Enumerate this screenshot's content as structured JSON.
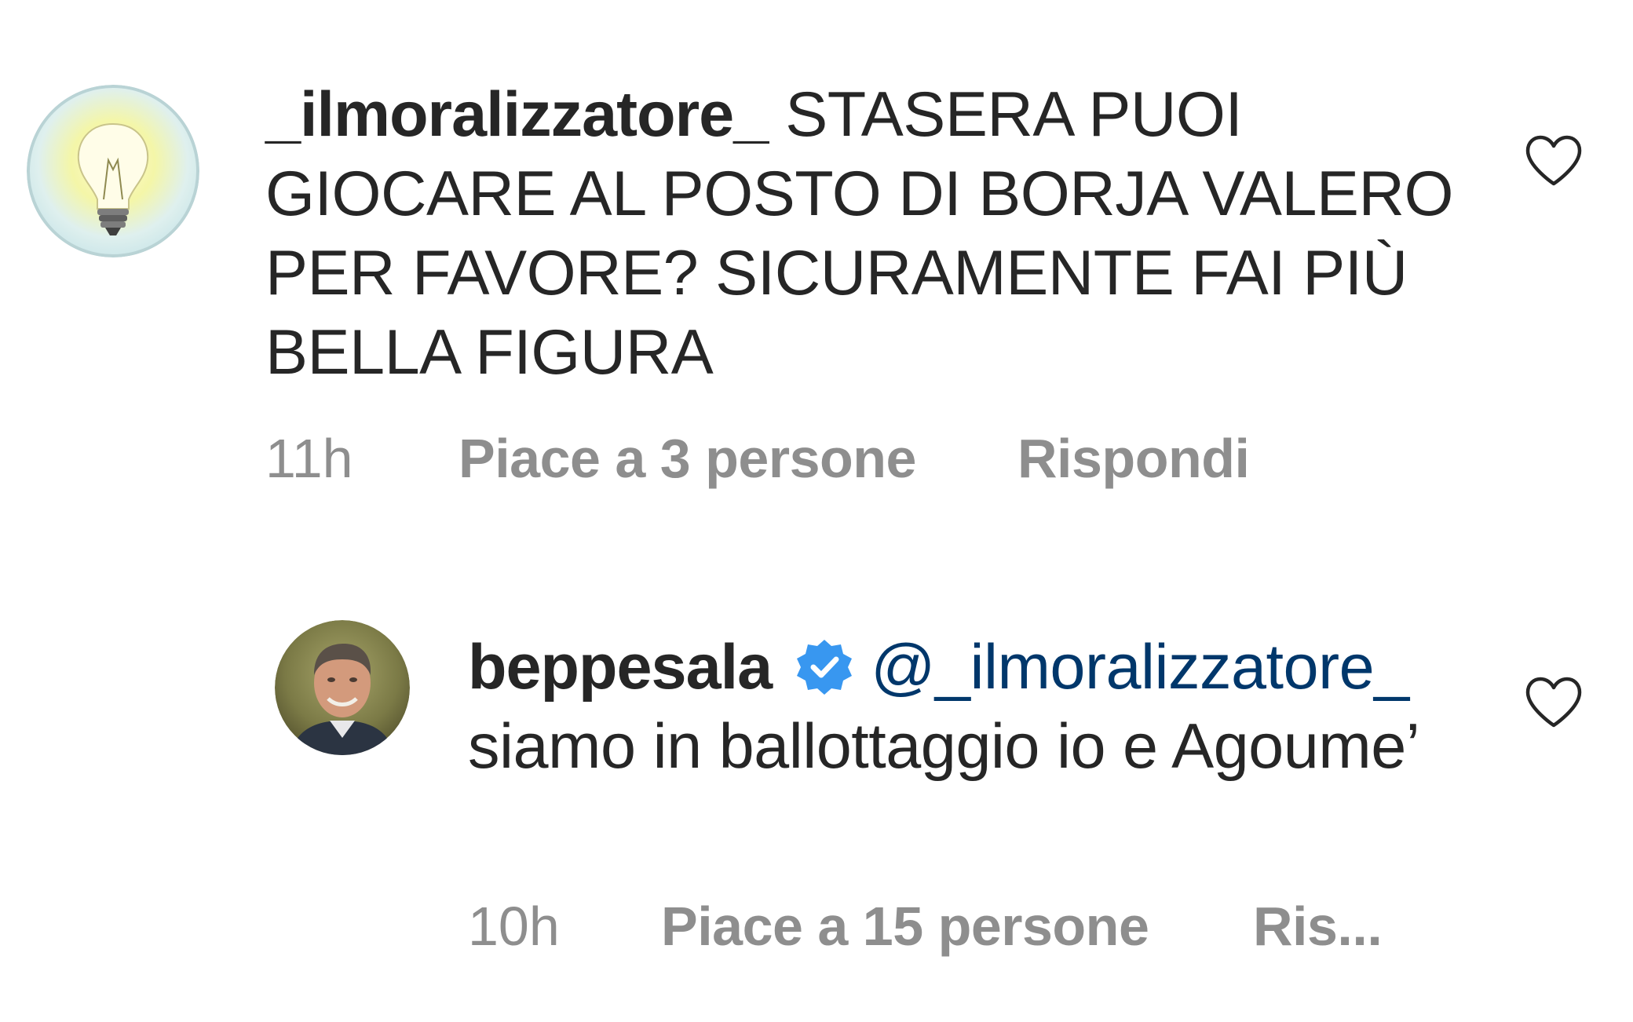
{
  "comments": [
    {
      "username": "_ilmoralizzatore_",
      "verified": false,
      "mention": "",
      "text": "STASERA PUOI GIOCARE AL POSTO DI BORJA VALERO PER FAVORE? SICURAMENTE FAI PIÙ BELLA FIGURA",
      "time": "11h",
      "likes": "Piace a 3 persone",
      "reply": "Rispondi",
      "avatar_icon": "lightbulb-icon"
    },
    {
      "username": "beppesala",
      "verified": true,
      "mention": "@_ilmoralizzatore_",
      "text": "siamo in ballottaggio io e Agoume’",
      "time": "10h",
      "likes": "Piace a 15 persone",
      "reply": "Ris...",
      "avatar_icon": "profile-photo"
    }
  ],
  "icons": {
    "like": "heart-outline-icon",
    "verified": "verified-badge-icon"
  },
  "colors": {
    "text": "#262626",
    "secondary": "#8e8e8e",
    "mention": "#00376b",
    "verified": "#3897f0"
  }
}
